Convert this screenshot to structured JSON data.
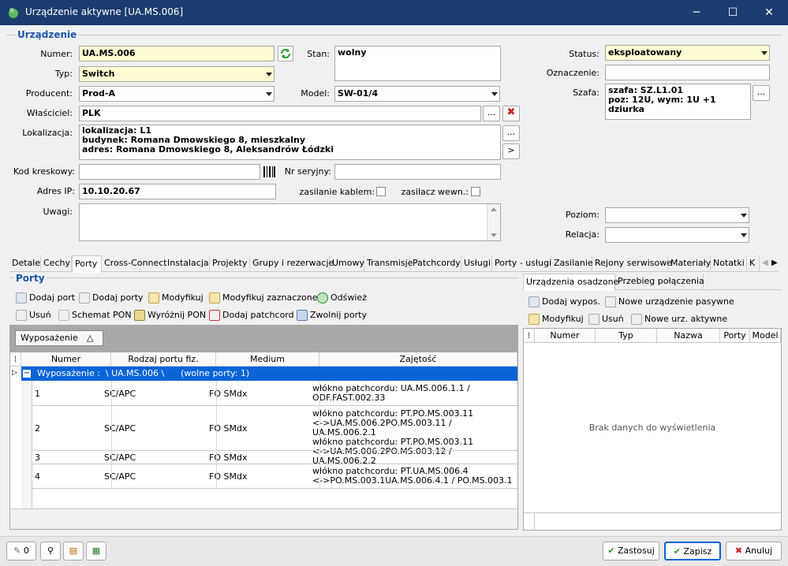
{
  "window": {
    "title": "Urządzenie aktywne [UA.MS.006]",
    "minimize": "─",
    "maximize": "☐",
    "close": "✕"
  },
  "group": {
    "title": "Urządzenie"
  },
  "fields": {
    "numer_label": "Numer:",
    "numer": "UA.MS.006",
    "typ_label": "Typ:",
    "typ": "Switch",
    "producent_label": "Producent:",
    "producent": "Prod-A",
    "wlasciciel_label": "Właściciel:",
    "wlasciciel": "PLK",
    "lokalizacja_label": "Lokalizacja:",
    "lokalizacja_1": "lokalizacja: L1",
    "lokalizacja_2": "budynek: Romana Dmowskiego 8, mieszkalny",
    "lokalizacja_3": "adres: Romana Dmowskiego 8, Aleksandrów Łódzki",
    "kod_label": "Kod kreskowy:",
    "kod": "",
    "adres_ip_label": "Adres IP:",
    "adres_ip": "10.10.20.67",
    "uwagi_label": "Uwagi:",
    "uwagi": "",
    "stan_label": "Stan:",
    "stan": "wolny",
    "model_label": "Model:",
    "model": "SW-01/4",
    "nr_seryjny_label": "Nr seryjny:",
    "nr_seryjny": "",
    "zasilanie_label": "zasilanie kablem:",
    "zasilacz_label": "zasilacz wewn.:",
    "status_label": "Status:",
    "status": "eksploatowany",
    "oznaczenie_label": "Oznaczenie:",
    "oznaczenie": "",
    "szafa_label": "Szafa:",
    "szafa_1": "szafa: SZ.L1.01",
    "szafa_2": "poz: 12U,  wym: 1U +1 dziurka",
    "poziom_label": "Poziom:",
    "poziom": "",
    "relacja_label": "Relacja:",
    "relacja": "",
    "ellipsis": "...",
    "arrow": ">"
  },
  "tabs": [
    "Detale",
    "Cechy",
    "Porty",
    "Cross-Connect",
    "Instalacja",
    "Projekty",
    "Grupy i rezerwacje",
    "Umowy",
    "Transmisje",
    "Patchcordy",
    "Usługi",
    "Porty - usługi",
    "Zasilanie",
    "Rejony serwisowe",
    "Materiały",
    "Notatki",
    "K"
  ],
  "ports": {
    "title": "Porty",
    "toolbar": [
      "Dodaj port",
      "Dodaj porty",
      "Modyfikuj",
      "Modyfikuj zaznaczone",
      "Odśwież",
      "Usuń",
      "Schemat PON",
      "Wyróżnij PON",
      "Dodaj patchcord",
      "Zwolnij porty"
    ],
    "group_chip": "Wyposażenie",
    "group_chip_arrow": "△",
    "columns": [
      "Numer",
      "Rodzaj portu fiz.",
      "Medium",
      "Zajętość"
    ],
    "group_row": "Wyposażenie :  \\ UA.MS.006 \\      (wolne porty: 1)",
    "rows": [
      {
        "numer": "1",
        "rodzaj": "SC/APC",
        "medium": "FO SMdx",
        "zajetosc_1": "włókno patchcordu: UA.MS.006.1.1 /",
        "zajetosc_2": "ODF.FAST.002.33",
        "zajetosc_3": "",
        "zajetosc_4": ""
      },
      {
        "numer": "2",
        "rodzaj": "SC/APC",
        "medium": "FO SMdx",
        "zajetosc_1": "włókno patchcordu: PT.PO.MS.003.11",
        "zajetosc_2": "<->UA.MS.006.2PO.MS.003.11 / UA.MS.006.2.1",
        "zajetosc_3": "włókno patchcordu: PT.PO.MS.003.11",
        "zajetosc_4": "<->UA.MS.006.2PO.MS.003.12 / UA.MS.006.2.2"
      },
      {
        "numer": "3",
        "rodzaj": "SC/APC",
        "medium": "FO SMdx",
        "zajetosc_1": "",
        "zajetosc_2": "",
        "zajetosc_3": "",
        "zajetosc_4": ""
      },
      {
        "numer": "4",
        "rodzaj": "SC/APC",
        "medium": "FO SMdx",
        "zajetosc_1": "włókno patchcordu: PT.UA.MS.006.4",
        "zajetosc_2": "<->PO.MS.003.1UA.MS.006.4.1 / PO.MS.003.1",
        "zajetosc_3": "",
        "zajetosc_4": ""
      }
    ]
  },
  "right": {
    "tabs": [
      "Urządzenia osadzone",
      "Przebieg połączenia"
    ],
    "toolbar": [
      "Dodaj wypos.",
      "Nowe urządzenie pasywne",
      "Modyfikuj",
      "Usuń",
      "Nowe urz. aktywne"
    ],
    "columns": [
      "Numer",
      "Typ",
      "Nazwa",
      "Porty",
      "Model"
    ],
    "empty": "Brak danych do wyświetlenia"
  },
  "footer": {
    "attach_count": "0",
    "zastosuj": "Zastosuj",
    "zapisz": "Zapisz",
    "anuluj": "Anuluj"
  },
  "colors": {
    "titlebar": "#1a3c6e",
    "accent": "#1a56a8",
    "selected_row": "#0a64d8",
    "yellow_field": "#fffbd2"
  }
}
